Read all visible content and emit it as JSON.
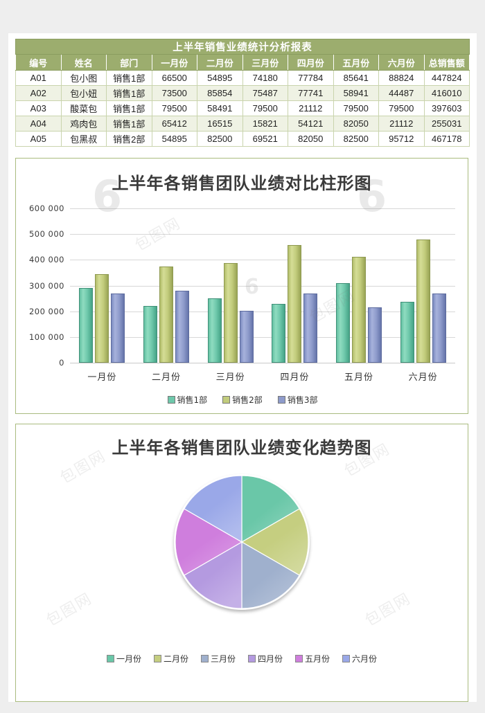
{
  "report": {
    "title": "上半年销售业绩统计分析报表",
    "columns": [
      "编号",
      "姓名",
      "部门",
      "一月份",
      "二月份",
      "三月份",
      "四月份",
      "五月份",
      "六月份",
      "总销售额"
    ],
    "rows": [
      {
        "id": "A01",
        "name": "包小图",
        "dept": "销售1部",
        "jan": "66500",
        "feb": "54895",
        "mar": "74180",
        "apr": "77784",
        "may": "85641",
        "jun": "88824",
        "total": "447824"
      },
      {
        "id": "A02",
        "name": "包小妞",
        "dept": "销售1部",
        "jan": "73500",
        "feb": "85854",
        "mar": "75487",
        "apr": "77741",
        "may": "58941",
        "jun": "44487",
        "total": "416010"
      },
      {
        "id": "A03",
        "name": "酸菜包",
        "dept": "销售1部",
        "jan": "79500",
        "feb": "58491",
        "mar": "79500",
        "apr": "21112",
        "may": "79500",
        "jun": "79500",
        "total": "397603"
      },
      {
        "id": "A04",
        "name": "鸡肉包",
        "dept": "销售1部",
        "jan": "65412",
        "feb": "16515",
        "mar": "15821",
        "apr": "54121",
        "may": "82050",
        "jun": "21112",
        "total": "255031"
      },
      {
        "id": "A05",
        "name": "包黑叔",
        "dept": "销售2部",
        "jan": "54895",
        "feb": "82500",
        "mar": "69521",
        "apr": "82050",
        "may": "82500",
        "jun": "95712",
        "total": "467178"
      }
    ]
  },
  "bar_panel": {
    "title": "上半年各销售团队业绩对比柱形图"
  },
  "pie_panel": {
    "title": "上半年各销售团队业绩变化趋势图"
  },
  "watermarks": {
    "big": "6",
    "text": "包图网"
  },
  "chart_data": [
    {
      "type": "bar",
      "title": "上半年各销售团队业绩对比柱形图",
      "xlabel": "",
      "ylabel": "",
      "ylim": [
        0,
        600000
      ],
      "ytick_labels": [
        "600 000",
        "500 000",
        "400 000",
        "300 000",
        "200 000",
        "100 000",
        "0"
      ],
      "ytick_values": [
        600000,
        500000,
        400000,
        300000,
        200000,
        100000,
        0
      ],
      "grid": true,
      "legend_position": "bottom",
      "categories": [
        "一月份",
        "二月份",
        "三月份",
        "四月份",
        "五月份",
        "六月份"
      ],
      "series": [
        {
          "name": "销售1部",
          "color": "#6ec8ab",
          "values": [
            290000,
            220000,
            250000,
            230000,
            310000,
            237000
          ]
        },
        {
          "name": "销售2部",
          "color": "#c2cc7c",
          "values": [
            345000,
            375000,
            388000,
            458000,
            412000,
            480000
          ]
        },
        {
          "name": "销售3部",
          "color": "#8e9bcb",
          "values": [
            270000,
            280000,
            202000,
            270000,
            215000,
            270000
          ]
        }
      ]
    },
    {
      "type": "pie",
      "title": "上半年各销售团队业绩变化趋势图",
      "legend_position": "bottom",
      "labels": [
        "一月份",
        "二月份",
        "三月份",
        "四月份",
        "五月份",
        "六月份"
      ],
      "values": [
        16.7,
        16.7,
        16.7,
        16.7,
        16.7,
        16.7
      ],
      "colors": [
        "#6ac7a8",
        "#c5ce80",
        "#9fb0cd",
        "#b49ae0",
        "#cf7edd",
        "#9aa8e8"
      ]
    }
  ]
}
